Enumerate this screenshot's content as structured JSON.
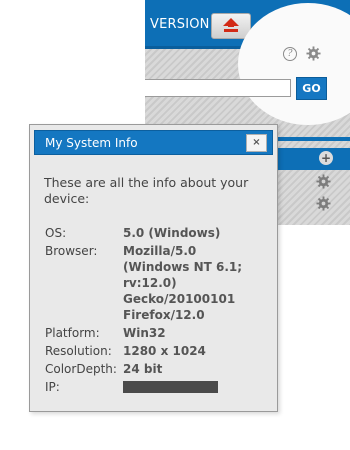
{
  "background": {
    "header": {
      "version_label": "VERSION",
      "up_button_icon": "up-arrow-icon"
    },
    "toolbar": {
      "help_glyph": "?",
      "settings_icon": "gear-icon"
    },
    "search": {
      "value": "",
      "go_label": "GO"
    },
    "rows": [
      {
        "icon": "plus-icon",
        "glyph": "+"
      },
      {
        "icon": "gear-icon"
      },
      {
        "icon": "gear-icon"
      }
    ],
    "colors": {
      "brand_blue": "#0d6fb6",
      "accent_red": "#d22a16"
    }
  },
  "dialog": {
    "title": "My System Info",
    "close_glyph": "×",
    "intro": "These are all the info about your device:",
    "fields": [
      {
        "label": "OS:",
        "value": "5.0 (Windows)"
      },
      {
        "label": "Browser:",
        "value": "Mozilla/5.0 (Windows NT 6.1; rv:12.0) Gecko/20100101 Firefox/12.0"
      },
      {
        "label": "Platform:",
        "value": "Win32"
      },
      {
        "label": "Resolution:",
        "value": "1280 x 1024"
      },
      {
        "label": "ColorDepth:",
        "value": "24 bit"
      },
      {
        "label": "IP:",
        "value": ""
      }
    ]
  }
}
